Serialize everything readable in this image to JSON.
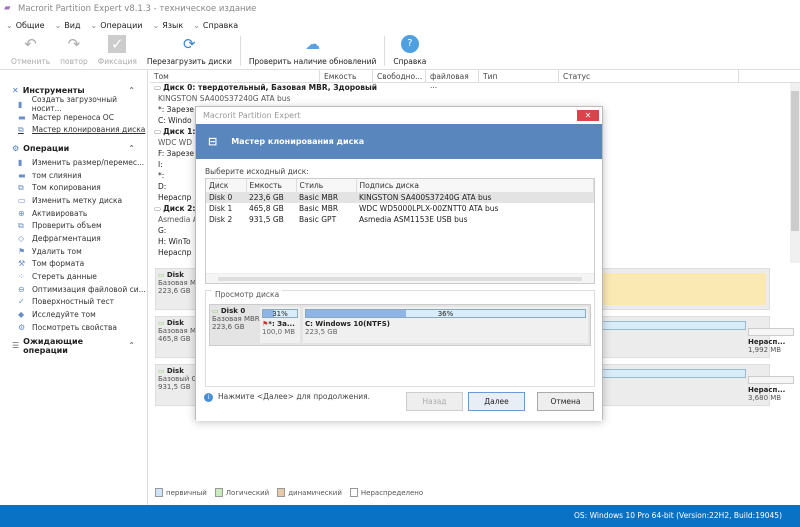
{
  "window": {
    "title": "Macrorit Partition Expert v8.1.3 - техническое издание"
  },
  "menu": [
    "Общие",
    "Вид",
    "Операции",
    "Язык",
    "Справка"
  ],
  "toolbar": {
    "undo": "Отменить",
    "redo": "повтор",
    "commit": "Фиксация",
    "reload": "Перезагрузить диски",
    "update": "Проверить наличие обновлений",
    "help": "Справка"
  },
  "sidebar": {
    "tools_title": "Инструменты",
    "tools": [
      "Создать загрузочный носит...",
      "Мастер переноса ОС",
      "Мастер клонирования диска"
    ],
    "ops_title": "Операции",
    "ops": [
      "Изменить размер/перемес...",
      "том слияния",
      "Том копирования",
      "Изменить метку диска",
      "Активировать",
      "Проверить объем",
      "Дефрагментация",
      "Удалить том",
      "Том формата",
      "Стереть данные",
      "Оптимизация файловой си...",
      "Поверхностный тест",
      "Исследуйте том",
      "Посмотреть свойства"
    ],
    "pending_title": "Ожидающие операции"
  },
  "columns": [
    "Том",
    "Емкость",
    "Свободно...",
    "файловая ...",
    "Тип",
    "Статус"
  ],
  "tree": [
    {
      "t": "Диск 0: твердотельный, Базовая MBR, Здоровый",
      "k": "b"
    },
    {
      "t": "KINGSTON SA400S37240G ATA bus",
      "k": "sub"
    },
    {
      "t": "*: Зарезе",
      "k": ""
    },
    {
      "t": "C: Windo",
      "k": ""
    },
    {
      "t": "Диск 1: 2",
      "k": "b"
    },
    {
      "t": "WDC WD",
      "k": "sub"
    },
    {
      "t": "F: Зарезе",
      "k": ""
    },
    {
      "t": "I:",
      "k": ""
    },
    {
      "t": "*:",
      "k": ""
    },
    {
      "t": "D:",
      "k": ""
    },
    {
      "t": "Нераспр",
      "k": ""
    },
    {
      "t": "Диск 2: 9",
      "k": "b"
    },
    {
      "t": "Asmedia A",
      "k": "sub"
    },
    {
      "t": "G:",
      "k": ""
    },
    {
      "t": "H: WinTo",
      "k": ""
    },
    {
      "t": "Нераспр",
      "k": ""
    }
  ],
  "disk_map": [
    {
      "name": "Disk",
      "type": "Базовая MB",
      "size": "223,6 GB"
    },
    {
      "name": "Disk",
      "type": "Базовая MB",
      "size": "465,8 GB",
      "unalloc_label": "Нерасп...",
      "unalloc_size": "1,992 MB"
    },
    {
      "name": "Disk",
      "type": "Базовый GF",
      "size": "931,5 GB",
      "unalloc_label": "Нерасп...",
      "unalloc_size": "3,680 MB"
    }
  ],
  "legend": [
    "первичный",
    "Логический",
    "динамический",
    "Нераспределено"
  ],
  "status": "OS: Windows 10 Pro 64-bit (Version:22H2, Build:19045)",
  "dialog": {
    "title": "Macrorit Partition Expert",
    "header": "Мастер клонирования диска",
    "select_label": "Выберите исходный диск:",
    "columns": [
      "Диск",
      "Емкость",
      "Стиль",
      "Подпись диска"
    ],
    "rows": [
      [
        "Disk 0",
        "223,6 GB",
        "Basic MBR",
        "KINGSTON SA400S37240G ATA bus"
      ],
      [
        "Disk 1",
        "465,8 GB",
        "Basic MBR",
        "WDC WD5000LPLX-00ZNTT0 ATA bus"
      ],
      [
        "Disk 2",
        "931,5 GB",
        "Basic GPT",
        "Asmedia ASM1153E USB bus"
      ]
    ],
    "preview_label": "Просмотр диска",
    "preview": {
      "disk": "Disk 0",
      "type": "Базовая MBR",
      "size": "223,6 GB",
      "p1_pct": "31%",
      "p1_used": 0.31,
      "p1_name": "*: За...",
      "p1_size": "100,0 MB",
      "p2_pct": "36%",
      "p2_used": 0.36,
      "p2_name": "C: Windows 10(NTFS)",
      "p2_size": "223,5 GB"
    },
    "hint": "Нажмите <Далее> для продолжения.",
    "back": "Назад",
    "next": "Далее",
    "cancel": "Отмена"
  }
}
